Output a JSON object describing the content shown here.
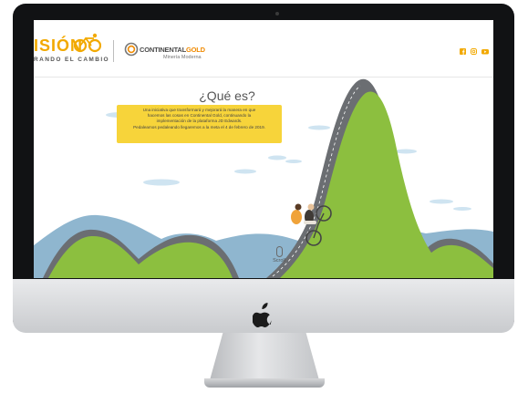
{
  "header": {
    "brand_title": "ISIÓN",
    "brand_tagline": "RANDO EL CAMBIO",
    "company_name_prefix": "CONTINENTAL",
    "company_name_suffix": "GOLD",
    "company_subtitle": "Minería Moderna",
    "social": [
      "facebook-icon",
      "instagram-icon",
      "youtube-icon"
    ]
  },
  "main": {
    "title": "¿Qué es?",
    "description_lines": [
      "Una iniciativa que transformará y mejorará la manera en que",
      "hacemos las cosas en Continental Gold, continuando la",
      "implementación de la plataforma JD Edwards.",
      "Pedaleamos pedaleando llegaremos a la meta el 4 de febrero de 2019."
    ],
    "scroll_label": "Scroll"
  },
  "colors": {
    "brand_yellow": "#f2a900",
    "info_box": "#f7d43a",
    "hill_green": "#8cbf3f",
    "road_gray": "#6b6e72",
    "mountain_blue": "#8fb6cf"
  }
}
